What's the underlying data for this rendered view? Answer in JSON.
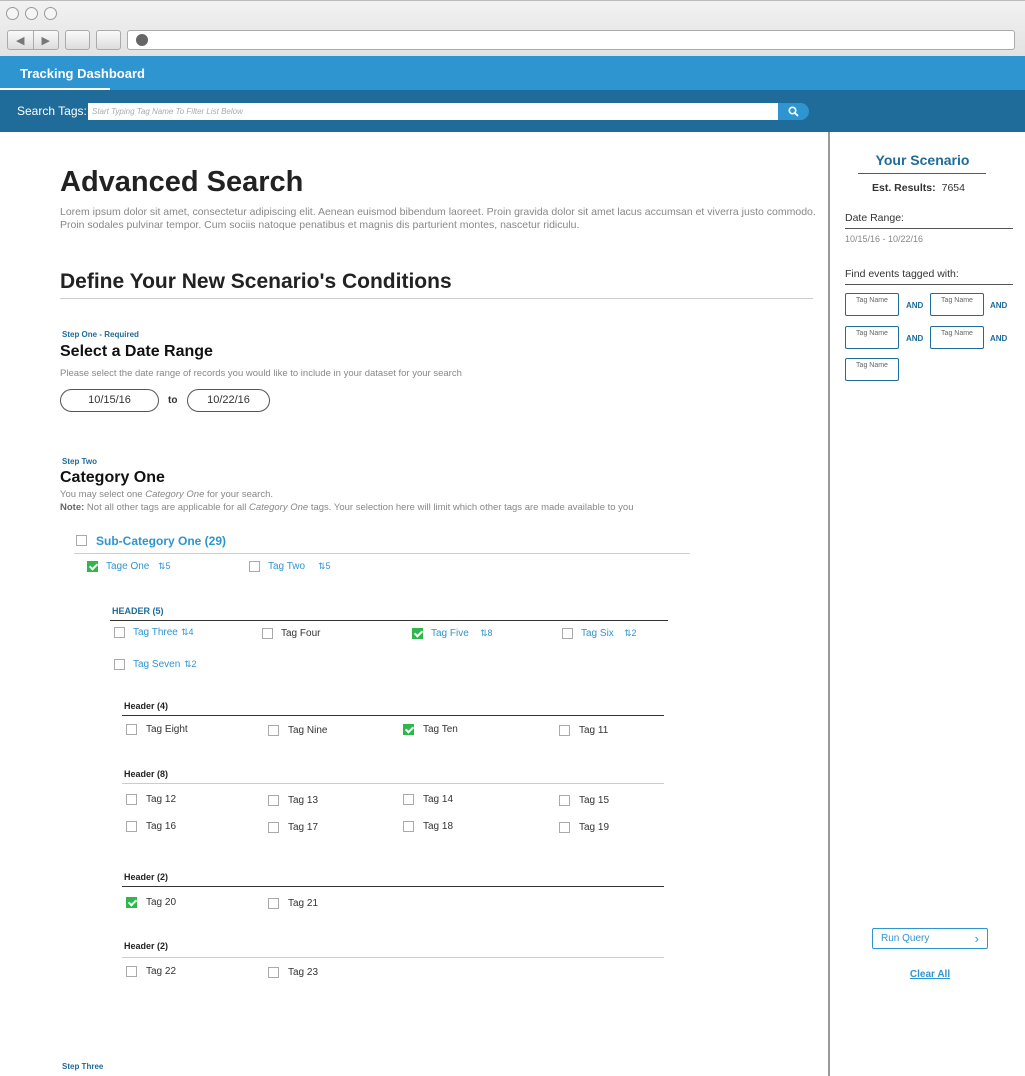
{
  "app": {
    "title": "Tracking Dashboard"
  },
  "search": {
    "label": "Search Tags:",
    "placeholder": "Start Typing Tag Name To Filter List Below"
  },
  "main": {
    "heading": "Advanced Search",
    "intro": "Lorem ipsum dolor sit amet, consectetur adipiscing elit. Aenean euismod bibendum laoreet. Proin gravida dolor sit amet lacus accumsan et viverra justo commodo. Proin sodales pulvinar tempor. Cum sociis natoque penatibus et magnis dis parturient montes, nascetur ridiculu.",
    "conditions_heading": "Define Your New Scenario's Conditions",
    "step_one": {
      "label": "Step One - Required",
      "title": "Select a Date Range",
      "help": "Please select the date range of records you would like to include in your dataset for your search",
      "from": "10/15/16",
      "to_label": "to",
      "to": "10/22/16"
    },
    "step_two": {
      "label": "Step  Two",
      "title": "Category One",
      "help_line1_a": "You may select one ",
      "help_line1_em": "Category One",
      "help_line1_b": " for your search.",
      "note_label": "Note:",
      "help_line2_a": " Not all other tags are applicable for all ",
      "help_line2_em": "Category One",
      "help_line2_b": " tags. Your selection here will limit which other tags are made available to you"
    },
    "subcategory": {
      "label": "Sub-Category One (29)",
      "checked": false
    },
    "sub_tags": [
      {
        "label": "Tage One",
        "count": "5",
        "checked": true
      },
      {
        "label": "Tag Two",
        "count": "5",
        "checked": false
      }
    ],
    "group_a": {
      "header": "HEADER (5)",
      "tags": [
        {
          "label": "Tag Three",
          "count": "4",
          "checked": false
        },
        {
          "label": "Tag Four",
          "count": "",
          "checked": false
        },
        {
          "label": "Tag Five",
          "count": "8",
          "checked": true
        },
        {
          "label": "Tag Six",
          "count": "2",
          "checked": false
        },
        {
          "label": "Tag Seven",
          "count": "2",
          "checked": false
        }
      ]
    },
    "group_b": {
      "header": "Header (4)",
      "tags": [
        {
          "label": "Tag Eight",
          "checked": false
        },
        {
          "label": "Tag Nine",
          "checked": false
        },
        {
          "label": "Tag Ten",
          "checked": true
        },
        {
          "label": "Tag 11",
          "checked": false
        }
      ]
    },
    "group_c": {
      "header": "Header (8)",
      "tags": [
        {
          "label": "Tag 12",
          "checked": false
        },
        {
          "label": "Tag 13",
          "checked": false
        },
        {
          "label": "Tag 14",
          "checked": false
        },
        {
          "label": "Tag 15",
          "checked": false
        },
        {
          "label": "Tag 16",
          "checked": false
        },
        {
          "label": "Tag 17",
          "checked": false
        },
        {
          "label": "Tag 18",
          "checked": false
        },
        {
          "label": "Tag 19",
          "checked": false
        }
      ]
    },
    "group_d": {
      "header": "Header (2)",
      "tags": [
        {
          "label": "Tag 20",
          "checked": true
        },
        {
          "label": "Tag 21",
          "checked": false
        }
      ]
    },
    "group_e": {
      "header": "Header (2)",
      "tags": [
        {
          "label": "Tag 22",
          "checked": false
        },
        {
          "label": "Tag 23",
          "checked": false
        }
      ]
    },
    "step_three": {
      "label": "Step Three"
    }
  },
  "sidebar": {
    "title": "Your Scenario",
    "est_label": "Est. Results:",
    "est_value": "7654",
    "date_label": "Date Range:",
    "date_value": "10/15/16 - 10/22/16",
    "tags_label": "Find events tagged with:",
    "tag_placeholder": "Tag Name",
    "and_label": "AND",
    "run_label": "Run Query",
    "clear_label": "Clear All"
  },
  "colors": {
    "brand": "#2f95d1",
    "brand_dark": "#1f6b99",
    "check": "#2db84b"
  },
  "icons": [
    "back-arrow-icon",
    "forward-arrow-icon",
    "globe-icon",
    "search-icon",
    "sort-count-icon",
    "chevron-right-icon"
  ]
}
